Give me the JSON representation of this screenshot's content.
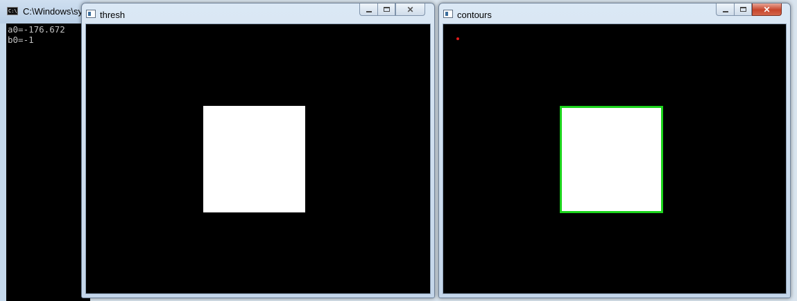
{
  "console": {
    "title": "C:\\Windows\\sy",
    "icon": "cmd-icon",
    "lines": [
      "a0=-176.672",
      "b0=-1"
    ]
  },
  "thresh_window": {
    "title": "thresh",
    "icon": "window-app-icon"
  },
  "contours_window": {
    "title": "contours",
    "icon": "window-app-icon"
  },
  "colors": {
    "canvas": "#000000",
    "shape": "#ffffff",
    "contour": "#1cd41c",
    "marker": "#e21b1b",
    "close_active": "#c7452b"
  }
}
